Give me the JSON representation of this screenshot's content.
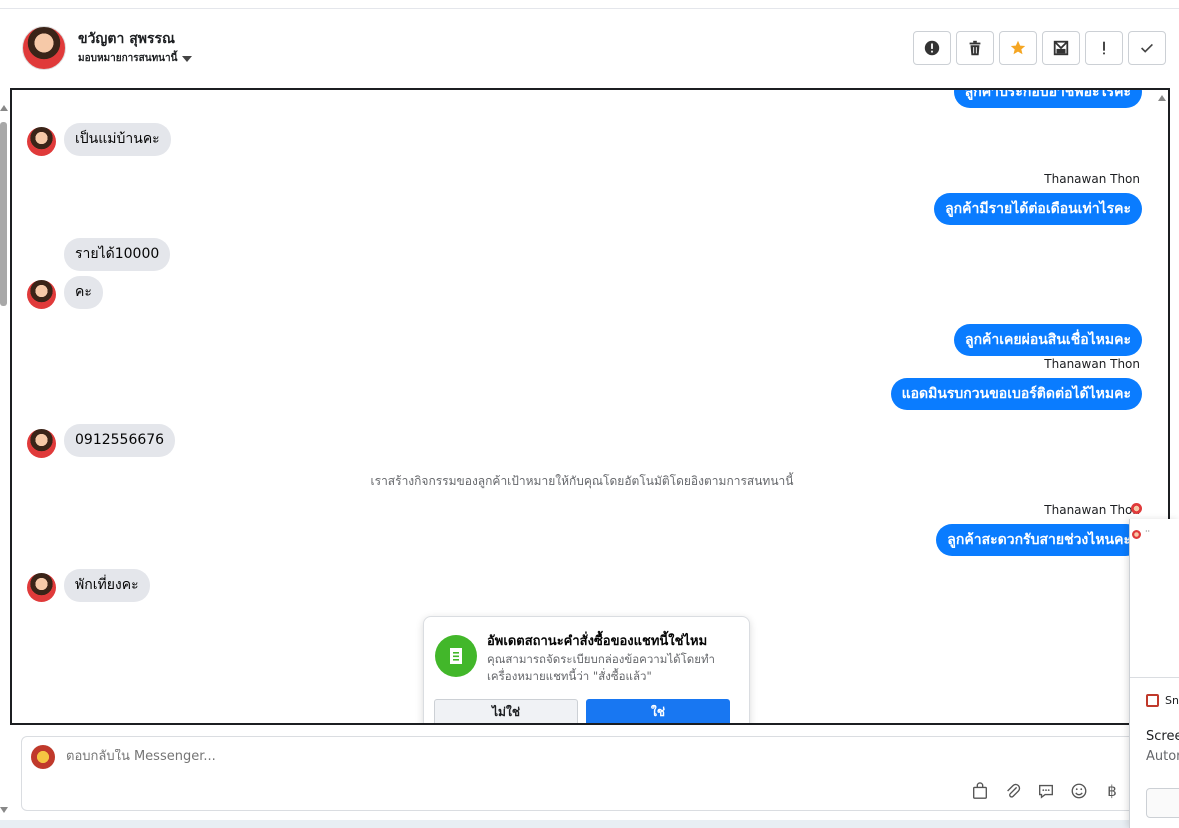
{
  "header": {
    "contact_name": "ขวัญตา สุพรรณ",
    "assign_label": "มอบหมายการสนทนานี้"
  },
  "toolbar": {
    "icons": [
      "alert-circle-icon",
      "trash-icon",
      "star-icon",
      "mail-icon",
      "exclamation-icon",
      "check-icon"
    ],
    "star_color": "#f5a623"
  },
  "messages": {
    "out_0": "ลูกค้าประกอบอาชีพอะไรคะ",
    "in_1": "เป็นแม่บ้านคะ",
    "sender_2": "Thanawan Thon",
    "out_2": "ลูกค้ามีรายได้ต่อเดือนเท่าไรคะ",
    "in_3a": "รายได้10000",
    "in_3b": "คะ",
    "out_4": "ลูกค้าเคยผ่อนสินเชื่อไหมคะ",
    "sender_5": "Thanawan Thon",
    "out_5": "แอดมินรบกวนขอเบอร์ติดต่อได้ไหมคะ",
    "in_6": "0912556676",
    "system_note": "เราสร้างกิจกรรมของลูกค้าเป้าหมายให้กับคุณโดยอัตโนมัติโดยอิงตามการสนทนานี้",
    "sender_7": "Thanawan Thon",
    "out_7": "ลูกค้าสะดวกรับสายช่วงไหนคะ",
    "in_8": "พักเที่ยงคะ"
  },
  "order_card": {
    "title": "อัพเดตสถานะคำสั่งซื้อของแชทนี้ใช่ไหม",
    "description": "คุณสามารถจัดระเบียบกล่องข้อความได้โดยทำเครื่องหมายแชทนี้ว่า \"สั่งซื้อแล้ว\"",
    "no_label": "ไม่ใช่",
    "yes_label": "ใช่",
    "accent": "#42b72a",
    "primary": "#1877f2"
  },
  "composer": {
    "placeholder": "ตอบกลับใน Messenger...",
    "tools": [
      "shopping-bag-icon",
      "paperclip-icon",
      "quick-reply-icon",
      "emoji-icon",
      "baht-icon"
    ]
  },
  "side_popup": {
    "snip_label": "Sn",
    "line1": "Scree",
    "line2": "Autom",
    "mini_text_2": "··"
  },
  "colors": {
    "bubble_out": "#0a7cff",
    "bubble_in": "#e4e6eb"
  }
}
